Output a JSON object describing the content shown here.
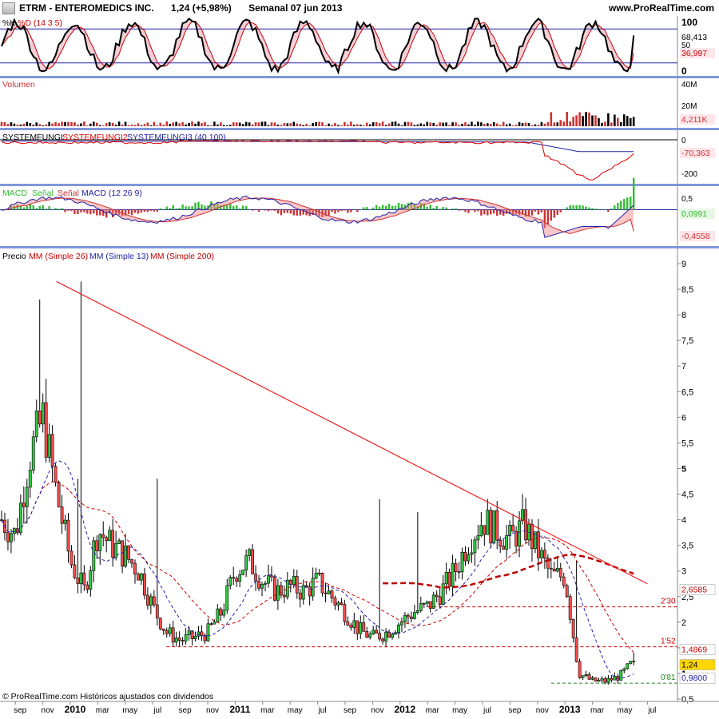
{
  "header": {
    "ticker": "ETRM - ENTEROMEDICS INC.",
    "quote": "1,24 (+5,98%)",
    "period": "Semanal  07 jun 2013",
    "site": "www.ProRealTime.com"
  },
  "footer": {
    "copyright": "© ProRealTime.com Históricos ajustados con dividendos"
  },
  "panels": {
    "stoch": {
      "legend": [
        "%K",
        "%D (14 3 5)"
      ],
      "value_k": "68,413",
      "value_d": "36,997",
      "axis_top": "100",
      "axis_mid": "50",
      "axis_bottom": "0"
    },
    "volume": {
      "legend": "Volumen",
      "axis_top": "40M",
      "axis_mid": "20M",
      "value": "4,211K"
    },
    "system": {
      "legend": [
        "SYSTEMFUNGI",
        "SYSTEMFUNGI2",
        "SYSTEMFUNGI3 (40 100)"
      ],
      "axis_top": "0",
      "axis_bottom": "-200",
      "value": "-70,363"
    },
    "macd": {
      "legend": [
        "MACD",
        "Señal",
        "Señal",
        "MACD (12 26 9)"
      ],
      "axis_top": "0,5",
      "value_macd": "0,0991",
      "value_signal": "-0,4558"
    },
    "price": {
      "legend": [
        "Precio",
        "MM (Simple 26)",
        "MM (Simple 13)",
        "MM (Simple 200)"
      ]
    }
  },
  "colors": {
    "up": "#2ecc40",
    "down": "#ff4d4d",
    "sma26": "#cc0000",
    "sma13": "#2222aa",
    "sma200": "#bb0000",
    "trend": "#ee2222",
    "hline": "#cc0000",
    "support": "#228b22",
    "panel_sep": "#7f97d8"
  },
  "chart_data": {
    "type": "candlestick",
    "title": "ETRM - ENTEROMEDICS INC.",
    "x_ticks": [
      "sep",
      "nov",
      "2010",
      "mar",
      "may",
      "jul",
      "sep",
      "nov",
      "2011",
      "mar",
      "may",
      "jul",
      "sep",
      "nov",
      "2012",
      "mar",
      "may",
      "jul",
      "sep",
      "nov",
      "2013",
      "mar",
      "may",
      "jul"
    ],
    "y_ticks": [
      "9",
      "8,5",
      "8",
      "7,5",
      "7",
      "6,5",
      "6",
      "5,5",
      "5",
      "4,5",
      "4",
      "3,5",
      "3",
      "2,5",
      "2",
      "1,5",
      "1",
      "0,5"
    ],
    "ylim": [
      0.5,
      9
    ],
    "last_price": "1,24",
    "sma26_last": "1,4869",
    "sma200_last": "2,6585",
    "sma13_last": "0,9800",
    "hlines": [
      {
        "label": "2'30",
        "value": 2.3
      },
      {
        "label": "1'52",
        "value": 1.52
      },
      {
        "label": "0'81",
        "value": 0.81
      }
    ],
    "trendline": {
      "from": [
        "2009-12",
        8.65
      ],
      "to": [
        "2013-07",
        2.75
      ]
    },
    "price_path": [
      [
        "2009-08",
        4.0
      ],
      [
        "2009-09",
        3.7
      ],
      [
        "2009-10",
        5.2
      ],
      [
        "2009-11",
        6.0
      ],
      [
        "2009-12",
        4.5
      ],
      [
        "2010-01",
        3.2
      ],
      [
        "2010-02",
        2.6
      ],
      [
        "2010-03",
        3.8
      ],
      [
        "2010-04",
        3.5
      ],
      [
        "2010-05",
        3.3
      ],
      [
        "2010-06",
        3.0
      ],
      [
        "2010-07",
        2.3
      ],
      [
        "2010-08",
        1.8
      ],
      [
        "2010-09",
        1.65
      ],
      [
        "2010-10",
        1.7
      ],
      [
        "2010-11",
        1.8
      ],
      [
        "2010-12",
        2.2
      ],
      [
        "2011-01",
        3.0
      ],
      [
        "2011-02",
        3.2
      ],
      [
        "2011-03",
        2.8
      ],
      [
        "2011-04",
        2.6
      ],
      [
        "2011-05",
        2.7
      ],
      [
        "2011-06",
        2.6
      ],
      [
        "2011-07",
        2.8
      ],
      [
        "2011-08",
        2.5
      ],
      [
        "2011-09",
        2.2
      ],
      [
        "2011-10",
        1.85
      ],
      [
        "2011-11",
        1.7
      ],
      [
        "2011-12",
        1.8
      ],
      [
        "2012-01",
        2.0
      ],
      [
        "2012-02",
        2.2
      ],
      [
        "2012-03",
        2.3
      ],
      [
        "2012-04",
        2.6
      ],
      [
        "2012-05",
        3.0
      ],
      [
        "2012-06",
        3.6
      ],
      [
        "2012-07",
        4.0
      ],
      [
        "2012-08",
        3.8
      ],
      [
        "2012-09",
        3.6
      ],
      [
        "2012-10",
        3.9
      ],
      [
        "2012-11",
        3.4
      ],
      [
        "2012-12",
        2.9
      ],
      [
        "2013-01",
        2.9
      ],
      [
        "2013-02",
        1.0
      ],
      [
        "2013-03",
        0.85
      ],
      [
        "2013-04",
        0.85
      ],
      [
        "2013-05",
        0.95
      ],
      [
        "2013-06",
        1.24
      ]
    ],
    "panels": {
      "stochastic": {
        "overbought": 80,
        "oversold": 20,
        "k_last": 68.413,
        "d_last": 36.997
      },
      "volume": {
        "last": "4,211K"
      },
      "systemfungi": {
        "last": -70.363
      },
      "macd": {
        "macd_last": 0.0991,
        "signal_last": -0.4558
      }
    }
  }
}
